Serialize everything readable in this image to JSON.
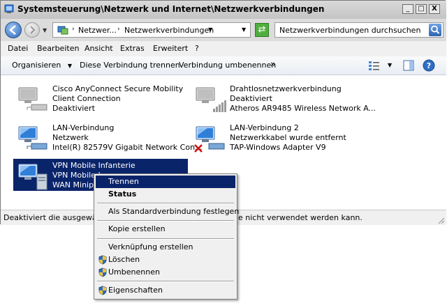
{
  "window": {
    "title": "Systemsteuerung\\Netzwerk und Internet\\Netzwerkverbindungen",
    "min_label": "_",
    "max_label": "□",
    "close_label": "X"
  },
  "address": {
    "crumb1": "Netzwer...",
    "crumb2": "Netzwerkverbindungen",
    "search_placeholder": "Netzwerkverbindungen durchsuchen"
  },
  "menu": [
    "Datei",
    "Bearbeiten",
    "Ansicht",
    "Extras",
    "Erweitert",
    "?"
  ],
  "commands": {
    "organize": "Organisieren",
    "disconnect": "Diese Verbindung trennen",
    "rename": "Verbindung umbenennen",
    "more": "»"
  },
  "connections": [
    {
      "name": "Cisco AnyConnect Secure Mobility",
      "line2": "Client Connection",
      "line3": "Deaktiviert",
      "icon": "network-adapter-disabled-icon"
    },
    {
      "name": "Drahtlosnetzwerkverbindung",
      "line2": "Deaktiviert",
      "line3": "Atheros AR9485 Wireless Network A...",
      "icon": "wireless-adapter-disabled-icon"
    },
    {
      "name": "LAN-Verbindung",
      "line2": "Netzwerk",
      "line3": "Intel(R) 82579V Gigabit Network Con...",
      "icon": "network-adapter-icon"
    },
    {
      "name": "LAN-Verbindung 2",
      "line2": "Netzwerkkabel wurde entfernt",
      "line3": "TAP-Windows Adapter V9",
      "icon": "network-adapter-unplugged-icon"
    },
    {
      "name": "VPN Mobile Infanterie",
      "line2": "VPN Mobile I",
      "line3": "WAN Minipor",
      "icon": "vpn-connection-icon"
    }
  ],
  "status": {
    "left": "Deaktiviert die ausgewähl",
    "right": "e nicht verwendet werden kann."
  },
  "context_menu": [
    {
      "label": "Trennen",
      "style": "highlighted"
    },
    {
      "label": "Status",
      "style": "bold"
    },
    {
      "label": "Als Standardverbindung festlegen"
    },
    {
      "label": "Kopie erstellen"
    },
    {
      "label": "Verknüpfung erstellen"
    },
    {
      "label": "Löschen",
      "icon": "uac-shield-icon"
    },
    {
      "label": "Umbenennen",
      "icon": "uac-shield-icon"
    },
    {
      "label": "Eigenschaften",
      "icon": "uac-shield-icon"
    }
  ],
  "colors": {
    "selection": "#0a246a",
    "titlebar": "#c4c4c4"
  }
}
